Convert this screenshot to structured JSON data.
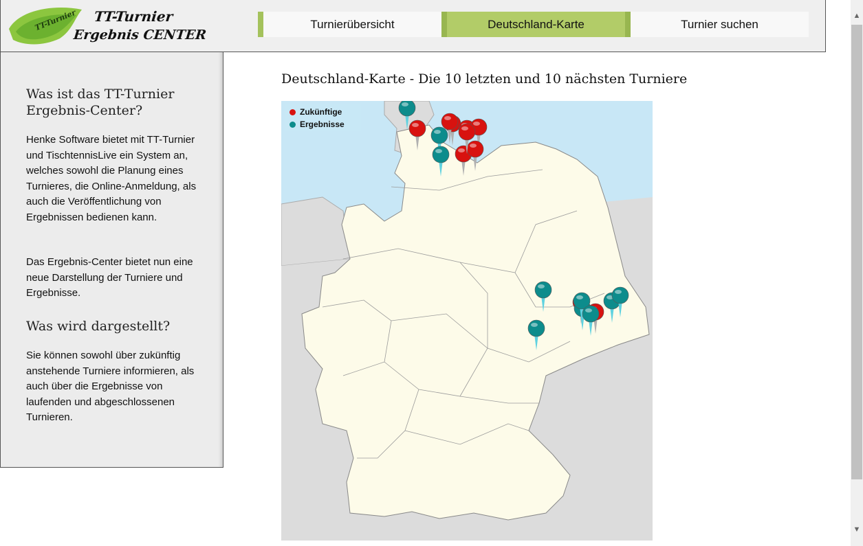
{
  "logo": {
    "line1": "TT-Turnier",
    "line2": "Ergebnis CENTER",
    "badge": "TT-Turnier"
  },
  "nav": {
    "items": [
      {
        "label": "Turnierübersicht"
      },
      {
        "label": "Deutschland-Karte"
      },
      {
        "label": "Turnier suchen"
      }
    ],
    "active": "Deutschland-Karte",
    "active_color": "#b2cc68"
  },
  "sidebar": {
    "heading1": "Was ist das TT-Turnier Ergebnis-Center?",
    "para1": "Henke Software bietet mit TT-Turnier und TischtennisLive ein System an, welches sowohl die Planung eines Turnieres, die Online-Anmeldung, als auch die Veröffentlichung von Ergebnissen bedienen kann.",
    "para2": "Das Ergebnis-Center bietet nun eine neue Darstellung der Turniere und Ergebnisse.",
    "heading2": "Was wird dargestellt?",
    "para3": "Sie können sowohl über zukünftig anstehende Turniere informieren, als auch über die Ergebnisse von laufenden und abgeschlossenen Turnieren."
  },
  "main": {
    "title": "Deutschland-Karte - Die 10 letzten und 10 nächsten Turniere"
  },
  "map": {
    "legend": {
      "future_label": "Zukünftige",
      "results_label": "Ergebnisse"
    },
    "colors": {
      "future": "#d8120f",
      "results": "#0d8c8c",
      "land": "#fdfbe9",
      "sea": "#c8e7f6",
      "neighbors": "#dcdcdc"
    },
    "future_pin_count": 10,
    "results_pin_count": 10
  }
}
